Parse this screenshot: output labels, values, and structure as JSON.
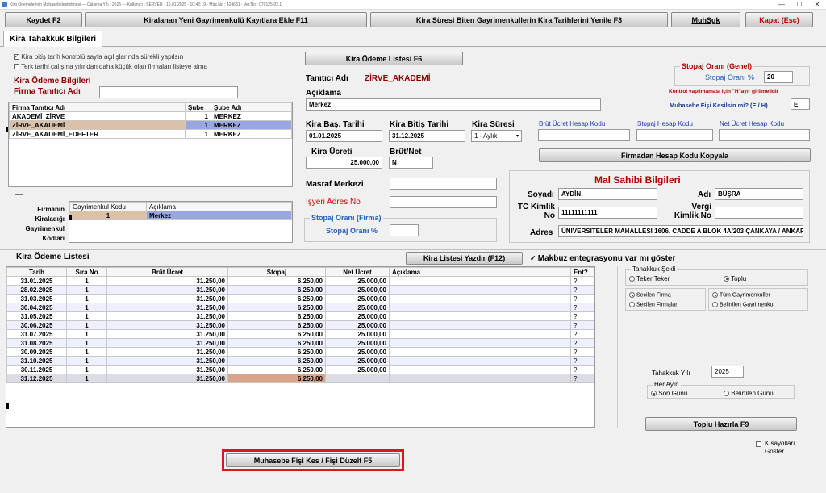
{
  "window": {
    "title": "Kira Ödemelerinin Muhasebeleştirilmesi  ---  Çalışma Yılı : 2025  ---  Kullanıcı : SERVER - 16.01.2025 - 10:42:19 - Müş.No : 424681 - Ver.No : 070125-02.1",
    "minimize": "—",
    "maximize": "☐",
    "close": "✕"
  },
  "toolbar": {
    "kaydet": "Kaydet F2",
    "kiralanan": "Kiralanan Yeni Gayrimenkulü Kayıtlara Ekle F11",
    "kira_suresi": "Kira Süresi Biten Gayrimenkullerin Kira Tarihlerini Yenile F3",
    "muhsgk": "MuhSgk",
    "kapat": "Kapat (Esc)"
  },
  "tab": {
    "label": "Kira Tahakkuk Bilgileri"
  },
  "options": {
    "opt1": "Kira bitiş tarih kontrolü sayfa açılışlarında sürekli yapılsın",
    "opt2": "Terk tarihi çalışma yılından daha küçük olan firmaları listeye alma",
    "check": "✓"
  },
  "kira_odeme_bilgileri": "Kira Ödeme Bilgileri",
  "firma_tanitici_adi_label": "Firma Tanıtıcı Adı",
  "firma_grid": {
    "headers": [
      "Firma Tanıtıcı Adı",
      "Şube",
      "Şube Adı"
    ],
    "rows": [
      [
        "AKADEMİ_ZİRVE",
        "1",
        "MERKEZ"
      ],
      [
        "ZİRVE_AKADEMİ",
        "1",
        "MERKEZ"
      ],
      [
        "ZİRVE_AKADEMİ_EDEFTER",
        "1",
        "MERKEZ"
      ]
    ]
  },
  "firmanin_label": "Firmanın Kiraladığı Gayrimenkul Kodları",
  "gayr_grid": {
    "headers": [
      "Gayrimenkul Kodu",
      "Açıklama"
    ],
    "rows": [
      [
        "1",
        "Merkez"
      ]
    ]
  },
  "kira_odeme_listesi_btn": "Kira Ödeme Listesi F6",
  "tanitici_adi": {
    "label": "Tanıtıcı Adı",
    "value": "ZİRVE_AKADEMİ"
  },
  "aciklama": {
    "label": "Açıklama",
    "value": "Merkez"
  },
  "kira_bas": {
    "label": "Kira Baş. Tarihi",
    "value": "01.01.2025"
  },
  "kira_bitis": {
    "label": "Kira Bitiş Tarihi",
    "value": "31.12.2025"
  },
  "kira_suresi": {
    "label": "Kira Süresi",
    "value": "1 - Aylık"
  },
  "kira_ucreti": {
    "label": "Kira Ücreti",
    "value": "25.000,00"
  },
  "brut_net": {
    "label": "Brüt/Net",
    "value": "N"
  },
  "masraf_merkezi": {
    "label": "Masraf Merkezi",
    "value": ""
  },
  "isyeri_adres": {
    "label": "İşyeri Adres No",
    "value": ""
  },
  "stopaj_firma": {
    "title": "Stopaj Oranı (Firma)",
    "label": "Stopaj Oranı %",
    "value": ""
  },
  "stopaj_genel": {
    "title": "Stopaj Oranı (Genel)",
    "label": "Stopaj Oranı %",
    "value": "20"
  },
  "kontrol_note": "Kontrol yapılmaması için \"H\"ayır girilmelidir",
  "muhasebe_fisi": {
    "label": "Muhasebe Fişi Kesilsin mi? (E / H)",
    "value": "E"
  },
  "hesap_kodlari": {
    "brut": "Brüt Ücret Hesap Kodu",
    "stopaj": "Stopaj Hesap Kodu",
    "net": "Net Ücret Hesap Kodu"
  },
  "firmadan_hesap_btn": "Firmadan Hesap Kodu Kopyala",
  "mal_sahibi": {
    "title": "Mal Sahibi Bilgileri",
    "soyadi_label": "Soyadı",
    "soyadi": "AYDİN",
    "adi_label": "Adı",
    "adi": "BÜŞRA",
    "tc_label": "TC Kimlik No",
    "tc": "11111111111",
    "vergi_label": "Vergi Kimlik No",
    "vergi": "",
    "adres_label": "Adres",
    "adres": "ÜNİVERSİTELER MAHALLESİ 1606. CADDE A BLOK 4A/203 ÇANKAYA / ANKARA"
  },
  "kira_listesi_label": "Kira Ödeme Listesi",
  "kira_listesi_yazdir": "Kira Listesi Yazdır (F12)",
  "makbuz": "Makbuz entegrasyonu var mı göster",
  "odeme_grid": {
    "headers": [
      "Tarih",
      "Sıra No",
      "Brüt Ücret",
      "Stopaj",
      "Net Ücret",
      "Açıklama",
      "Ent?"
    ],
    "rows": [
      [
        "31.01.2025",
        "1",
        "31.250,00",
        "6.250,00",
        "25.000,00",
        "",
        "?"
      ],
      [
        "28.02.2025",
        "1",
        "31.250,00",
        "6.250,00",
        "25.000,00",
        "",
        "?"
      ],
      [
        "31.03.2025",
        "1",
        "31.250,00",
        "6.250,00",
        "25.000,00",
        "",
        "?"
      ],
      [
        "30.04.2025",
        "1",
        "31.250,00",
        "6.250,00",
        "25.000,00",
        "",
        "?"
      ],
      [
        "31.05.2025",
        "1",
        "31.250,00",
        "6.250,00",
        "25.000,00",
        "",
        "?"
      ],
      [
        "30.06.2025",
        "1",
        "31.250,00",
        "6.250,00",
        "25.000,00",
        "",
        "?"
      ],
      [
        "31.07.2025",
        "1",
        "31.250,00",
        "6.250,00",
        "25.000,00",
        "",
        "?"
      ],
      [
        "31.08.2025",
        "1",
        "31.250,00",
        "6.250,00",
        "25.000,00",
        "",
        "?"
      ],
      [
        "30.09.2025",
        "1",
        "31.250,00",
        "6.250,00",
        "25.000,00",
        "",
        "?"
      ],
      [
        "31.10.2025",
        "1",
        "31.250,00",
        "6.250,00",
        "25.000,00",
        "",
        "?"
      ],
      [
        "30.11.2025",
        "1",
        "31.250,00",
        "6.250,00",
        "25.000,00",
        "",
        "?"
      ],
      [
        "31.12.2025",
        "1",
        "31.250,00",
        "6.250,00",
        "",
        "",
        "?"
      ]
    ]
  },
  "tahakkuk_sekli": {
    "title": "Tahakkuk Şekli",
    "teker": "Teker Teker",
    "toplu": "Toplu"
  },
  "firma_sec": {
    "secilen": "Seçilen Firma",
    "secilenler": "Seçilen Firmalar"
  },
  "gayr_sec": {
    "tum": "Tüm Gayrimenkuller",
    "belirtilen": "Belirtilen Gayrimenkul"
  },
  "tahakkuk_yili": {
    "label": "Tahakkuk Yılı",
    "value": "2025"
  },
  "her_ayin": {
    "title": "Her Ayın",
    "son": "Son Günü",
    "belirtilen": "Belirtilen Günü"
  },
  "toplu_hazirla": "Toplu Hazırla F9",
  "muhasebe_btn": "Muhasebe Fişi Kes / Fişi Düzelt F5",
  "kisayollar": "Kısayolları Göster"
}
